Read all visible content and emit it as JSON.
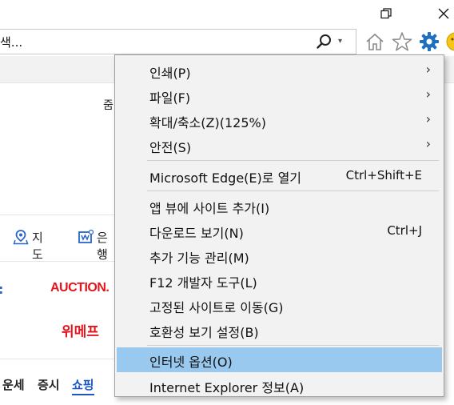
{
  "window": {
    "restore_glyph": "❐",
    "close_glyph": "✕"
  },
  "address_bar": {
    "text": "색...",
    "dropdown_glyph": "▾"
  },
  "toolbar_icons": [
    "home-icon",
    "favorites-star-icon",
    "tools-gear-icon",
    "smiley-feedback-icon"
  ],
  "page": {
    "zoom_fragment": "줌",
    "map_label": "지도",
    "bank_label": "은행",
    "auction_logo": "AUCTION.",
    "wemakeprice_logo": "위메프",
    "nav_items": [
      "운세",
      "증시",
      "쇼핑"
    ]
  },
  "menu": {
    "items": [
      {
        "label": "인쇄(P)",
        "submenu": true
      },
      {
        "label": "파일(F)",
        "submenu": true
      },
      {
        "label": "확대/축소(Z)(125%)",
        "submenu": true
      },
      {
        "label": "안전(S)",
        "submenu": true
      },
      {
        "label": "Microsoft Edge(E)로 열기",
        "shortcut": "Ctrl+Shift+E"
      },
      {
        "label": "앱 뷰에 사이트 추가(I)"
      },
      {
        "label": "다운로드 보기(N)",
        "shortcut": "Ctrl+J"
      },
      {
        "label": "추가 기능 관리(M)"
      },
      {
        "label": "F12 개발자 도구(L)"
      },
      {
        "label": "고정된 사이트로 이동(G)"
      },
      {
        "label": "호환성 보기 설정(B)"
      },
      {
        "label": "인터넷 옵션(O)",
        "highlighted": true
      },
      {
        "label": "Internet Explorer 정보(A)"
      }
    ],
    "arrow_glyph": "›"
  },
  "colors": {
    "highlight": "#99c9ef",
    "menu_bg": "#f2f2f2",
    "gear": "#1e6fc0",
    "auction": "#e3141d",
    "wemakeprice": "#e3141d",
    "shopping_link": "#1a56c4"
  }
}
